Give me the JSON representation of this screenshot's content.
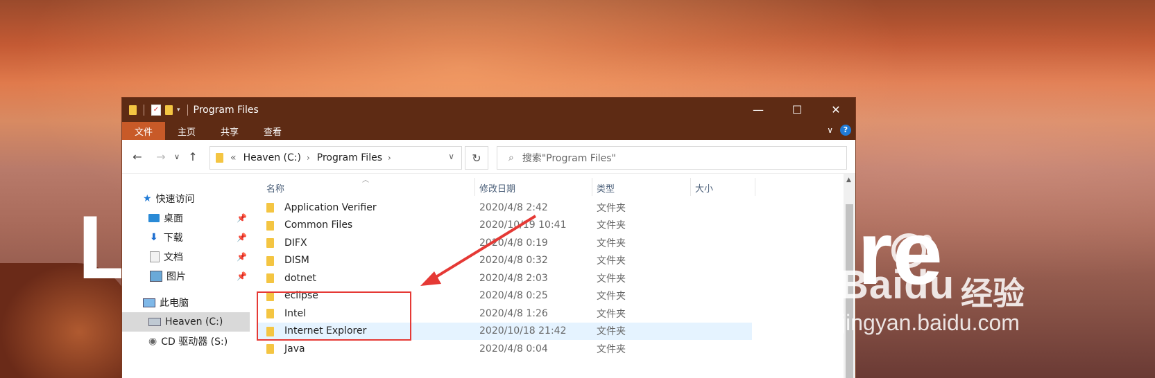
{
  "window": {
    "title": "Program Files",
    "buttons": {
      "minimize": "—",
      "maximize": "☐",
      "close": "✕"
    }
  },
  "ribbon": {
    "tabs": [
      {
        "label": "文件",
        "active": true
      },
      {
        "label": "主页",
        "active": false
      },
      {
        "label": "共享",
        "active": false
      },
      {
        "label": "查看",
        "active": false
      }
    ],
    "help": "?"
  },
  "address": {
    "overflow": "«",
    "crumbs": [
      "Heaven (C:)",
      "Program Files"
    ],
    "search_placeholder": "搜索\"Program Files\""
  },
  "nav": {
    "quick_access": "快速访问",
    "items": [
      {
        "label": "桌面",
        "pinned": true
      },
      {
        "label": "下载",
        "pinned": true
      },
      {
        "label": "文档",
        "pinned": true
      },
      {
        "label": "图片",
        "pinned": true
      }
    ],
    "this_pc": "此电脑",
    "drives": [
      {
        "label": "Heaven (C:)",
        "selected": true
      },
      {
        "label": "CD 驱动器 (S:)",
        "selected": false
      }
    ]
  },
  "columns": {
    "name": "名称",
    "modified": "修改日期",
    "type": "类型",
    "size": "大小"
  },
  "files": [
    {
      "name": "Application Verifier",
      "date": "2020/4/8 2:42",
      "type": "文件夹"
    },
    {
      "name": "Common Files",
      "date": "2020/10/19 10:41",
      "type": "文件夹"
    },
    {
      "name": "DIFX",
      "date": "2020/4/8 0:19",
      "type": "文件夹"
    },
    {
      "name": "DISM",
      "date": "2020/4/8 0:32",
      "type": "文件夹"
    },
    {
      "name": "dotnet",
      "date": "2020/4/8 2:03",
      "type": "文件夹"
    },
    {
      "name": "eclipse",
      "date": "2020/4/8 0:25",
      "type": "文件夹"
    },
    {
      "name": "Intel",
      "date": "2020/4/8 1:26",
      "type": "文件夹"
    },
    {
      "name": "Internet Explorer",
      "date": "2020/10/18 21:42",
      "type": "文件夹"
    },
    {
      "name": "Java",
      "date": "2020/4/8 0:04",
      "type": "文件夹"
    }
  ],
  "watermark": {
    "brand_left": "Bai",
    "brand_right": "du",
    "cn": "经验",
    "url": "jingyan.baidu.com"
  },
  "desktop_text": {
    "left": "L",
    "right": "re"
  },
  "colors": {
    "titlebar": "#5e2b14",
    "active_tab": "#c85a28",
    "highlight": "#e53935",
    "folder": "#f4c542"
  }
}
